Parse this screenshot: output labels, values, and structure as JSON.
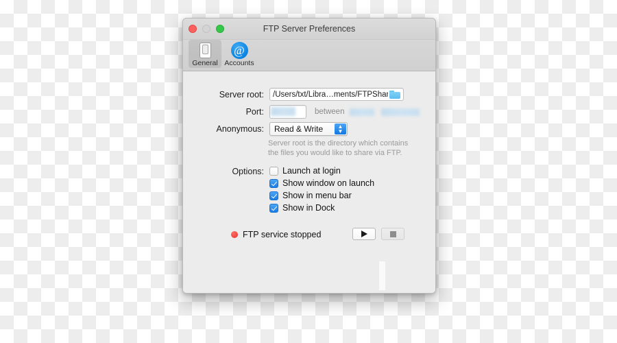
{
  "window": {
    "title": "FTP Server Preferences",
    "traffic_lights": [
      {
        "name": "close",
        "color": "#fc615d"
      },
      {
        "name": "minimize",
        "color": "#d4d4d4"
      },
      {
        "name": "zoom",
        "color": "#34c749"
      }
    ]
  },
  "toolbar": {
    "items": [
      {
        "label": "General",
        "icon": "switch-icon",
        "selected": true
      },
      {
        "label": "Accounts",
        "icon": "at-sign-icon",
        "selected": false
      }
    ]
  },
  "form": {
    "server_root": {
      "label": "Server root:",
      "value": "/Users/txt/Libra…ments/FTPShare",
      "icon": "folder-icon"
    },
    "port": {
      "label": "Port:",
      "value": "",
      "redacted": true,
      "between_label": "between",
      "range_redacted": true
    },
    "anonymous": {
      "label": "Anonymous:",
      "value": "Read & Write",
      "options": [
        "Read & Write"
      ],
      "icon": "chevron-updown-icon"
    },
    "help_text": "Server root is the directory which contains the files you would like to share via FTP."
  },
  "options": {
    "label": "Options:",
    "items": [
      {
        "label": "Launch at login",
        "checked": false
      },
      {
        "label": "Show window on launch",
        "checked": true
      },
      {
        "label": "Show in menu bar",
        "checked": true
      },
      {
        "label": "Show in Dock",
        "checked": true
      }
    ]
  },
  "status": {
    "text": "FTP service stopped",
    "indicator": "red-dot-icon",
    "indicator_color": "#e8332b",
    "start_button": {
      "icon": "play-icon",
      "enabled": true
    },
    "stop_button": {
      "icon": "stop-icon",
      "enabled": false
    }
  },
  "colors": {
    "accent": "#1a7de5",
    "toolbar_bg": "#d4d4d4",
    "content_bg": "#ececec",
    "status_red": "#e8332b"
  }
}
